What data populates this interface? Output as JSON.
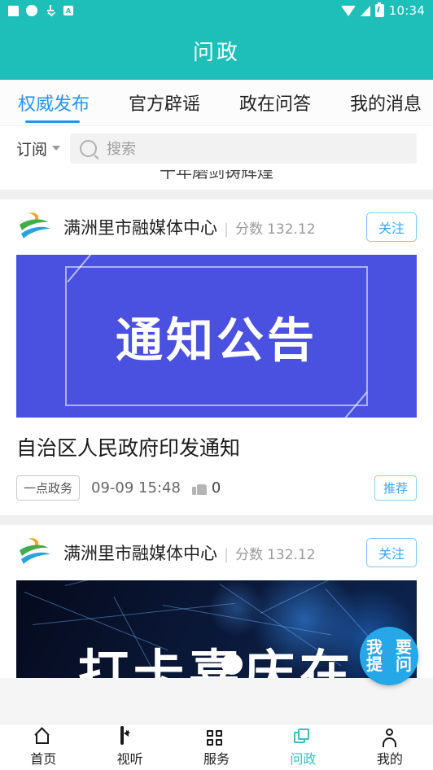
{
  "status_bar": {
    "time": "10:34",
    "icons": [
      "square-icon",
      "circle-icon",
      "download-icon",
      "app-badge-icon",
      "wifi-icon",
      "signal-icon",
      "battery-icon"
    ],
    "app_badge_letter": "A",
    "background_color": "#1EBFB8"
  },
  "app_bar": {
    "title": "问政",
    "background_color": "#1EBFB8",
    "title_color": "#FFFFFF"
  },
  "tabs": {
    "active_index": 0,
    "active_color": "#2196F3",
    "items": [
      {
        "label": "权威发布"
      },
      {
        "label": "官方辟谣"
      },
      {
        "label": "政在问答"
      },
      {
        "label": "我的消息"
      }
    ]
  },
  "search": {
    "subscribe_label": "订阅",
    "placeholder": "搜索",
    "value": ""
  },
  "feed": {
    "clipped_top_text": "十年磨剑铸辉煌",
    "cards": [
      {
        "publisher": {
          "name": "满洲里市融媒体中心",
          "divider": "|",
          "score_label": "分数",
          "score_value": "132.12",
          "follow_label": "关注",
          "logo": "swirl-ribbon-logo"
        },
        "banner": {
          "type": "notice",
          "text": "通知公告",
          "background_color": "#4A50E0",
          "text_color": "#FFFFFF"
        },
        "title": "自治区人民政府印发通知",
        "meta": {
          "tag": "一点政务",
          "date": "09-09 15:48",
          "like_count": "0",
          "badge": "推荐"
        }
      },
      {
        "publisher": {
          "name": "满洲里市融媒体中心",
          "divider": "|",
          "score_label": "分数",
          "score_value": "132.12",
          "follow_label": "关注",
          "logo": "swirl-ribbon-logo"
        },
        "banner": {
          "type": "dark-tech",
          "text": "打卡喜庆在",
          "background_color": "#0A1736",
          "text_color": "#FFFFFF"
        }
      }
    ]
  },
  "fab": {
    "lines": [
      "我",
      "要",
      "提",
      "问"
    ],
    "background_color": "#26A7E8"
  },
  "bottom_nav": {
    "active_index": 3,
    "active_color": "#35C2BD",
    "items": [
      {
        "label": "首页",
        "icon": "home-icon"
      },
      {
        "label": "视听",
        "icon": "video-camera-icon"
      },
      {
        "label": "服务",
        "icon": "grid-apps-icon"
      },
      {
        "label": "问政",
        "icon": "layers-icon"
      },
      {
        "label": "我的",
        "icon": "person-icon"
      }
    ]
  }
}
